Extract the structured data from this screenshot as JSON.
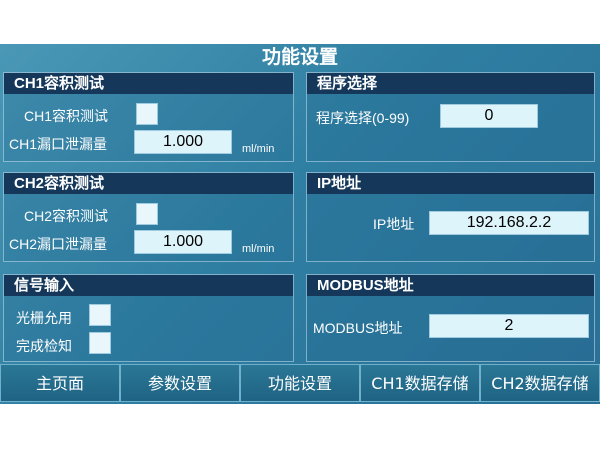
{
  "title": "功能设置",
  "ch1": {
    "header": "CH1容积测试",
    "test_label": "CH1容积测试",
    "leak_label": "CH1漏口泄漏量",
    "leak_value": "1.000",
    "unit": "ml/min"
  },
  "ch2": {
    "header": "CH2容积测试",
    "test_label": "CH2容积测试",
    "leak_label": "CH2漏口泄漏量",
    "leak_value": "1.000",
    "unit": "ml/min"
  },
  "signal": {
    "header": "信号输入",
    "grating_label": "光栅允用",
    "complete_label": "完成检知"
  },
  "program": {
    "header": "程序选择",
    "label": "程序选择(0-99)",
    "value": "0"
  },
  "ip": {
    "header": "IP地址",
    "label": "IP地址",
    "value": "192.168.2.2"
  },
  "modbus": {
    "header": "MODBUS地址",
    "label": "MODBUS地址",
    "value": "2"
  },
  "nav": {
    "home": "主页面",
    "params": "参数设置",
    "function": "功能设置",
    "ch1_storage": "CH1数据存储",
    "ch2_storage": "CH2数据存储"
  }
}
